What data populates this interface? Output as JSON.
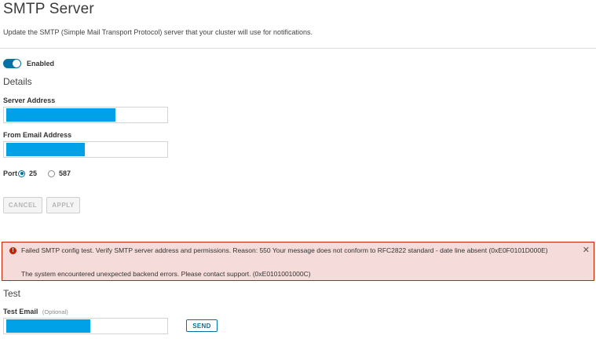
{
  "header": {
    "title": "SMTP Server",
    "description": "Update the SMTP (Simple Mail Transport Protocol) server that your cluster will use for notifications."
  },
  "toggle": {
    "label": "Enabled",
    "state": "on",
    "color": "#0072a3"
  },
  "details": {
    "section_title": "Details",
    "server_address": {
      "label": "Server Address",
      "value": "",
      "redacted": true
    },
    "from_email": {
      "label": "From Email Address",
      "value": "",
      "redacted": true
    },
    "port": {
      "label": "Port",
      "options": [
        "25",
        "587"
      ],
      "selected": "25"
    }
  },
  "actions": {
    "cancel_label": "CANCEL",
    "apply_label": "APPLY"
  },
  "alert": {
    "type": "error",
    "color": "#c92100",
    "message_1": "Failed SMTP config test. Verify SMTP server address and permissions. Reason: 550 Your message does not conform to RFC2822 standard - date line absent (0xE0F0101D000E)",
    "message_2": "The system encountered unexpected backend errors. Please contact support. (0xE0101001000C)",
    "close_icon": "close-icon"
  },
  "test": {
    "section_title": "Test",
    "email_label": "Test Email",
    "email_optional": "(Optional)",
    "email_value": "",
    "redacted": true,
    "send_label": "SEND"
  },
  "redaction_color": "#00a1e6"
}
